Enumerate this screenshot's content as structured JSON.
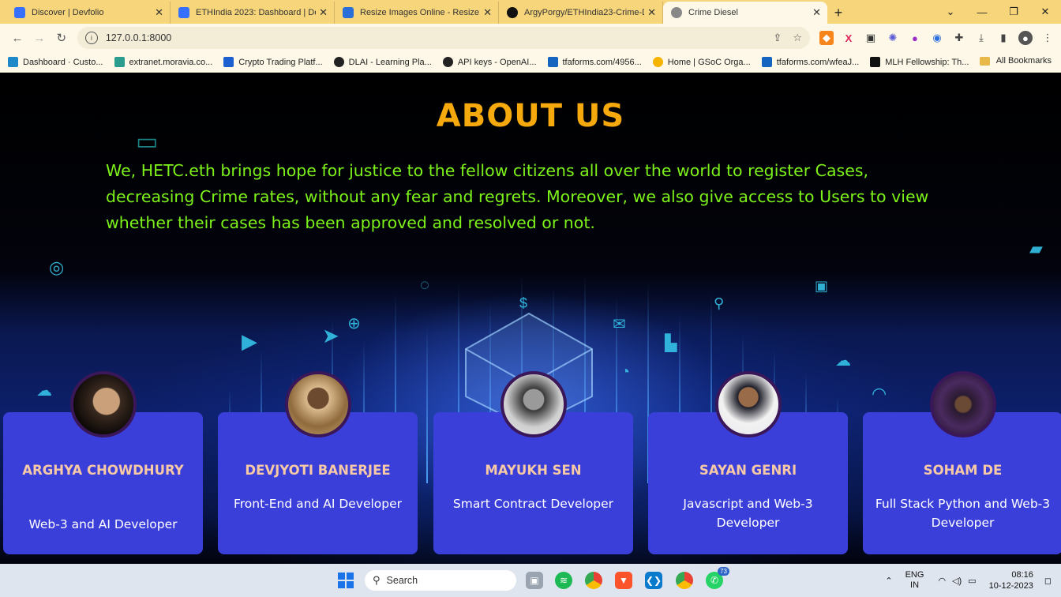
{
  "browser": {
    "tabs": [
      {
        "title": "Discover | Devfolio",
        "favicon_color": "#3770ff"
      },
      {
        "title": "ETHIndia 2023: Dashboard | Dev",
        "favicon_color": "#3770ff"
      },
      {
        "title": "Resize Images Online - Resize JP",
        "favicon_color": "#2a6ed8"
      },
      {
        "title": "ArgyPorgy/ETHIndia23-Crime-D",
        "favicon_color": "#111111"
      },
      {
        "title": "Crime Diesel",
        "favicon_color": "#888888"
      }
    ],
    "new_tab": "+",
    "address": "127.0.0.1:8000",
    "bookmarks": [
      {
        "label": "Dashboard · Custo...",
        "color": "#1e88c8"
      },
      {
        "label": "extranet.moravia.co...",
        "color": "#2a9d8f"
      },
      {
        "label": "Crypto Trading Platf...",
        "color": "#1c5fd1"
      },
      {
        "label": "DLAI - Learning Pla...",
        "color": "#222222"
      },
      {
        "label": "API keys - OpenAI...",
        "color": "#222222"
      },
      {
        "label": "tfaforms.com/4956...",
        "color": "#1565c0"
      },
      {
        "label": "Home | GSoC Orga...",
        "color": "#f4b400"
      },
      {
        "label": "tfaforms.com/wfeaJ...",
        "color": "#1565c0"
      },
      {
        "label": "MLH Fellowship: Th...",
        "color": "#111111"
      }
    ],
    "all_bookmarks": "All Bookmarks"
  },
  "about": {
    "title": "ABOUT US",
    "text": "We, HETC.eth brings hope for justice to the fellow citizens all over the world to register Cases, decreasing Crime rates, without any fear and regrets. Moreover, we also give access to Users to view whether their cases has been approved and resolved or not."
  },
  "team": [
    {
      "name": "ARGHYA CHOWDHURY",
      "role": "Web-3 and AI Developer"
    },
    {
      "name": "DEVJYOTI BANERJEE",
      "role": "Front-End and AI Developer"
    },
    {
      "name": "MAYUKH SEN",
      "role": "Smart Contract Developer"
    },
    {
      "name": "SAYAN GENRI",
      "role": "Javascript and Web-3 Developer"
    },
    {
      "name": "SOHAM DE",
      "role": "Full Stack Python and Web-3 Developer"
    }
  ],
  "taskbar": {
    "search_placeholder": "Search",
    "whatsapp_badge": "73",
    "lang_top": "ENG",
    "lang_bottom": "IN",
    "time": "08:16",
    "date": "10-12-2023"
  }
}
